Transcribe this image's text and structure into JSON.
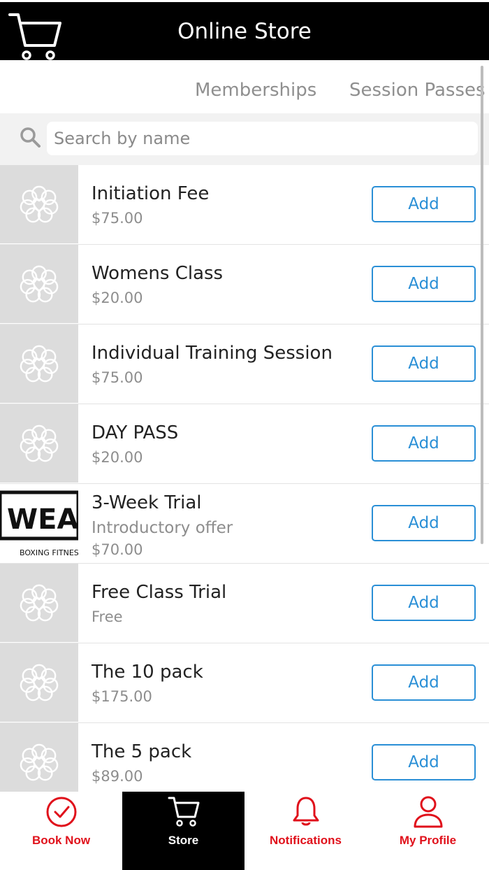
{
  "header": {
    "title": "Online Store",
    "icon": "cart-icon",
    "background_color": "#000000"
  },
  "tabs": [
    {
      "label": "Memberships"
    },
    {
      "label": "Session Passes"
    }
  ],
  "search": {
    "placeholder": "Search by name",
    "value": ""
  },
  "items": [
    {
      "name": "Initiation Fee",
      "price": "$75.00",
      "button": "Add",
      "thumbnail": "placeholder-flower-icon"
    },
    {
      "name": "Womens Class",
      "price": "$20.00",
      "button": "Add",
      "thumbnail": "placeholder-flower-icon"
    },
    {
      "name": "Individual Training Session",
      "price": "$75.00",
      "button": "Add",
      "thumbnail": "placeholder-flower-icon"
    },
    {
      "name": "DAY PASS",
      "price": "$20.00",
      "button": "Add",
      "thumbnail": "placeholder-flower-icon"
    },
    {
      "name": "3-Week Trial",
      "description": "Introductory offer",
      "price": "$70.00",
      "button": "Add",
      "thumbnail": "brand-logo",
      "logo_text": "WEAL",
      "logo_subtext": "BOXING FITNESS"
    },
    {
      "name": "Free Class Trial",
      "price": "Free",
      "button": "Add",
      "thumbnail": "placeholder-flower-icon"
    },
    {
      "name": "The 10 pack",
      "price": "$175.00",
      "button": "Add",
      "thumbnail": "placeholder-flower-icon"
    },
    {
      "name": "The 5 pack",
      "price": "$89.00",
      "button": "Add",
      "thumbnail": "placeholder-flower-icon"
    }
  ],
  "bottom_nav": [
    {
      "label": "Book Now",
      "icon": "check-circle-icon",
      "active": false
    },
    {
      "label": "Store",
      "icon": "cart-icon",
      "active": true
    },
    {
      "label": "Notifications",
      "icon": "bell-icon",
      "active": false
    },
    {
      "label": "My Profile",
      "icon": "user-icon",
      "active": false
    }
  ],
  "colors": {
    "accent_blue": "#2a8fd6",
    "nav_red": "#e0111b",
    "header_bg": "#000000",
    "thumb_bg": "#dcdcdc"
  }
}
